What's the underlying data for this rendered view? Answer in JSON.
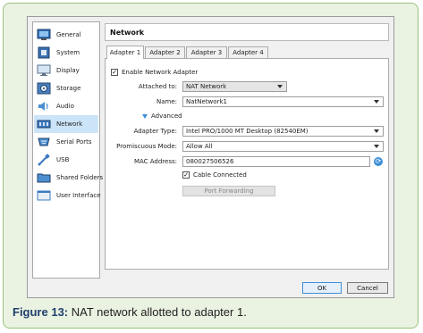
{
  "sidebar": {
    "items": [
      {
        "label": "General",
        "icon": "general-icon"
      },
      {
        "label": "System",
        "icon": "system-icon"
      },
      {
        "label": "Display",
        "icon": "display-icon"
      },
      {
        "label": "Storage",
        "icon": "storage-icon"
      },
      {
        "label": "Audio",
        "icon": "audio-icon"
      },
      {
        "label": "Network",
        "icon": "network-icon",
        "selected": true
      },
      {
        "label": "Serial Ports",
        "icon": "serial-ports-icon"
      },
      {
        "label": "USB",
        "icon": "usb-icon"
      },
      {
        "label": "Shared Folders",
        "icon": "shared-folders-icon"
      },
      {
        "label": "User Interface",
        "icon": "user-interface-icon"
      }
    ]
  },
  "main": {
    "title": "Network",
    "tabs": [
      {
        "label": "Adapter 1",
        "active": true
      },
      {
        "label": "Adapter 2"
      },
      {
        "label": "Adapter 3"
      },
      {
        "label": "Adapter 4"
      }
    ],
    "enable_adapter_label": "Enable Network Adapter",
    "enable_adapter_checked": true,
    "attached_to_label": "Attached to:",
    "attached_to_value": "NAT Network",
    "name_label": "Name:",
    "name_value": "NatNetwork1",
    "advanced_label": "Advanced",
    "adapter_type_label": "Adapter Type:",
    "adapter_type_value": "Intel PRO/1000 MT Desktop (82540EM)",
    "promiscuous_label": "Promiscuous Mode:",
    "promiscuous_value": "Allow All",
    "mac_label": "MAC Address:",
    "mac_value": "080027506526",
    "cable_label": "Cable Connected",
    "cable_checked": true,
    "port_forwarding_label": "Port Forwarding"
  },
  "footer": {
    "ok_label": "OK",
    "cancel_label": "Cancel"
  },
  "caption": {
    "prefix": "Figure 13:",
    "text": " NAT network allotted to adapter 1."
  },
  "colors": {
    "accent": "#3d8fd6",
    "selection": "#cce4f7",
    "frame_background": "#eaf2e1",
    "frame_border": "#9bc27d",
    "caption_prefix": "#1f3f6e"
  }
}
